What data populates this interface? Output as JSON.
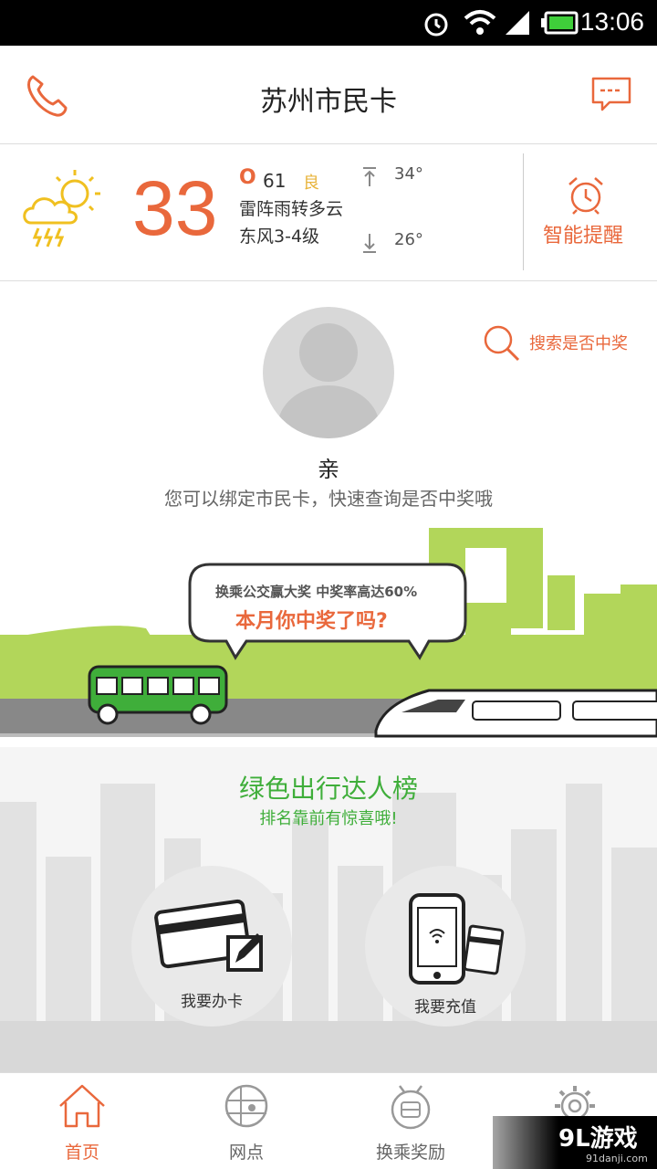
{
  "status_bar": {
    "time": "13:06"
  },
  "header": {
    "title": "苏州市民卡"
  },
  "weather": {
    "temperature": "33",
    "aqi_letter": "O",
    "aqi_value": "61",
    "aqi_level": "良",
    "condition": "雷阵雨转多云",
    "wind": "东风3-4级",
    "high": "34°",
    "low": "26°",
    "remind_label": "智能提醒"
  },
  "profile": {
    "search_label": "搜索是否中奖",
    "greeting": "亲",
    "hint": "您可以绑定市民卡，快速查询是否中奖哦"
  },
  "banner": {
    "line1": "换乘公交赢大奖 中奖率高达60%",
    "line2": "本月你中奖了吗?"
  },
  "green_section": {
    "title": "绿色出行达人榜",
    "subtitle": "排名靠前有惊喜哦!",
    "apply_card": "我要办卡",
    "recharge": "我要充值"
  },
  "bottom_nav": {
    "items": [
      {
        "label": "首页",
        "icon": "home-icon"
      },
      {
        "label": "网点",
        "icon": "location-grid-icon"
      },
      {
        "label": "换乘奖励",
        "icon": "bus-reward-icon"
      },
      {
        "label": "",
        "icon": "settings-gear-icon"
      }
    ]
  },
  "watermark": {
    "text": "9L游戏",
    "site": "91danji.com"
  },
  "colors": {
    "accent": "#e9683c",
    "green": "#3fae3a",
    "city_green": "#b2d65a"
  }
}
